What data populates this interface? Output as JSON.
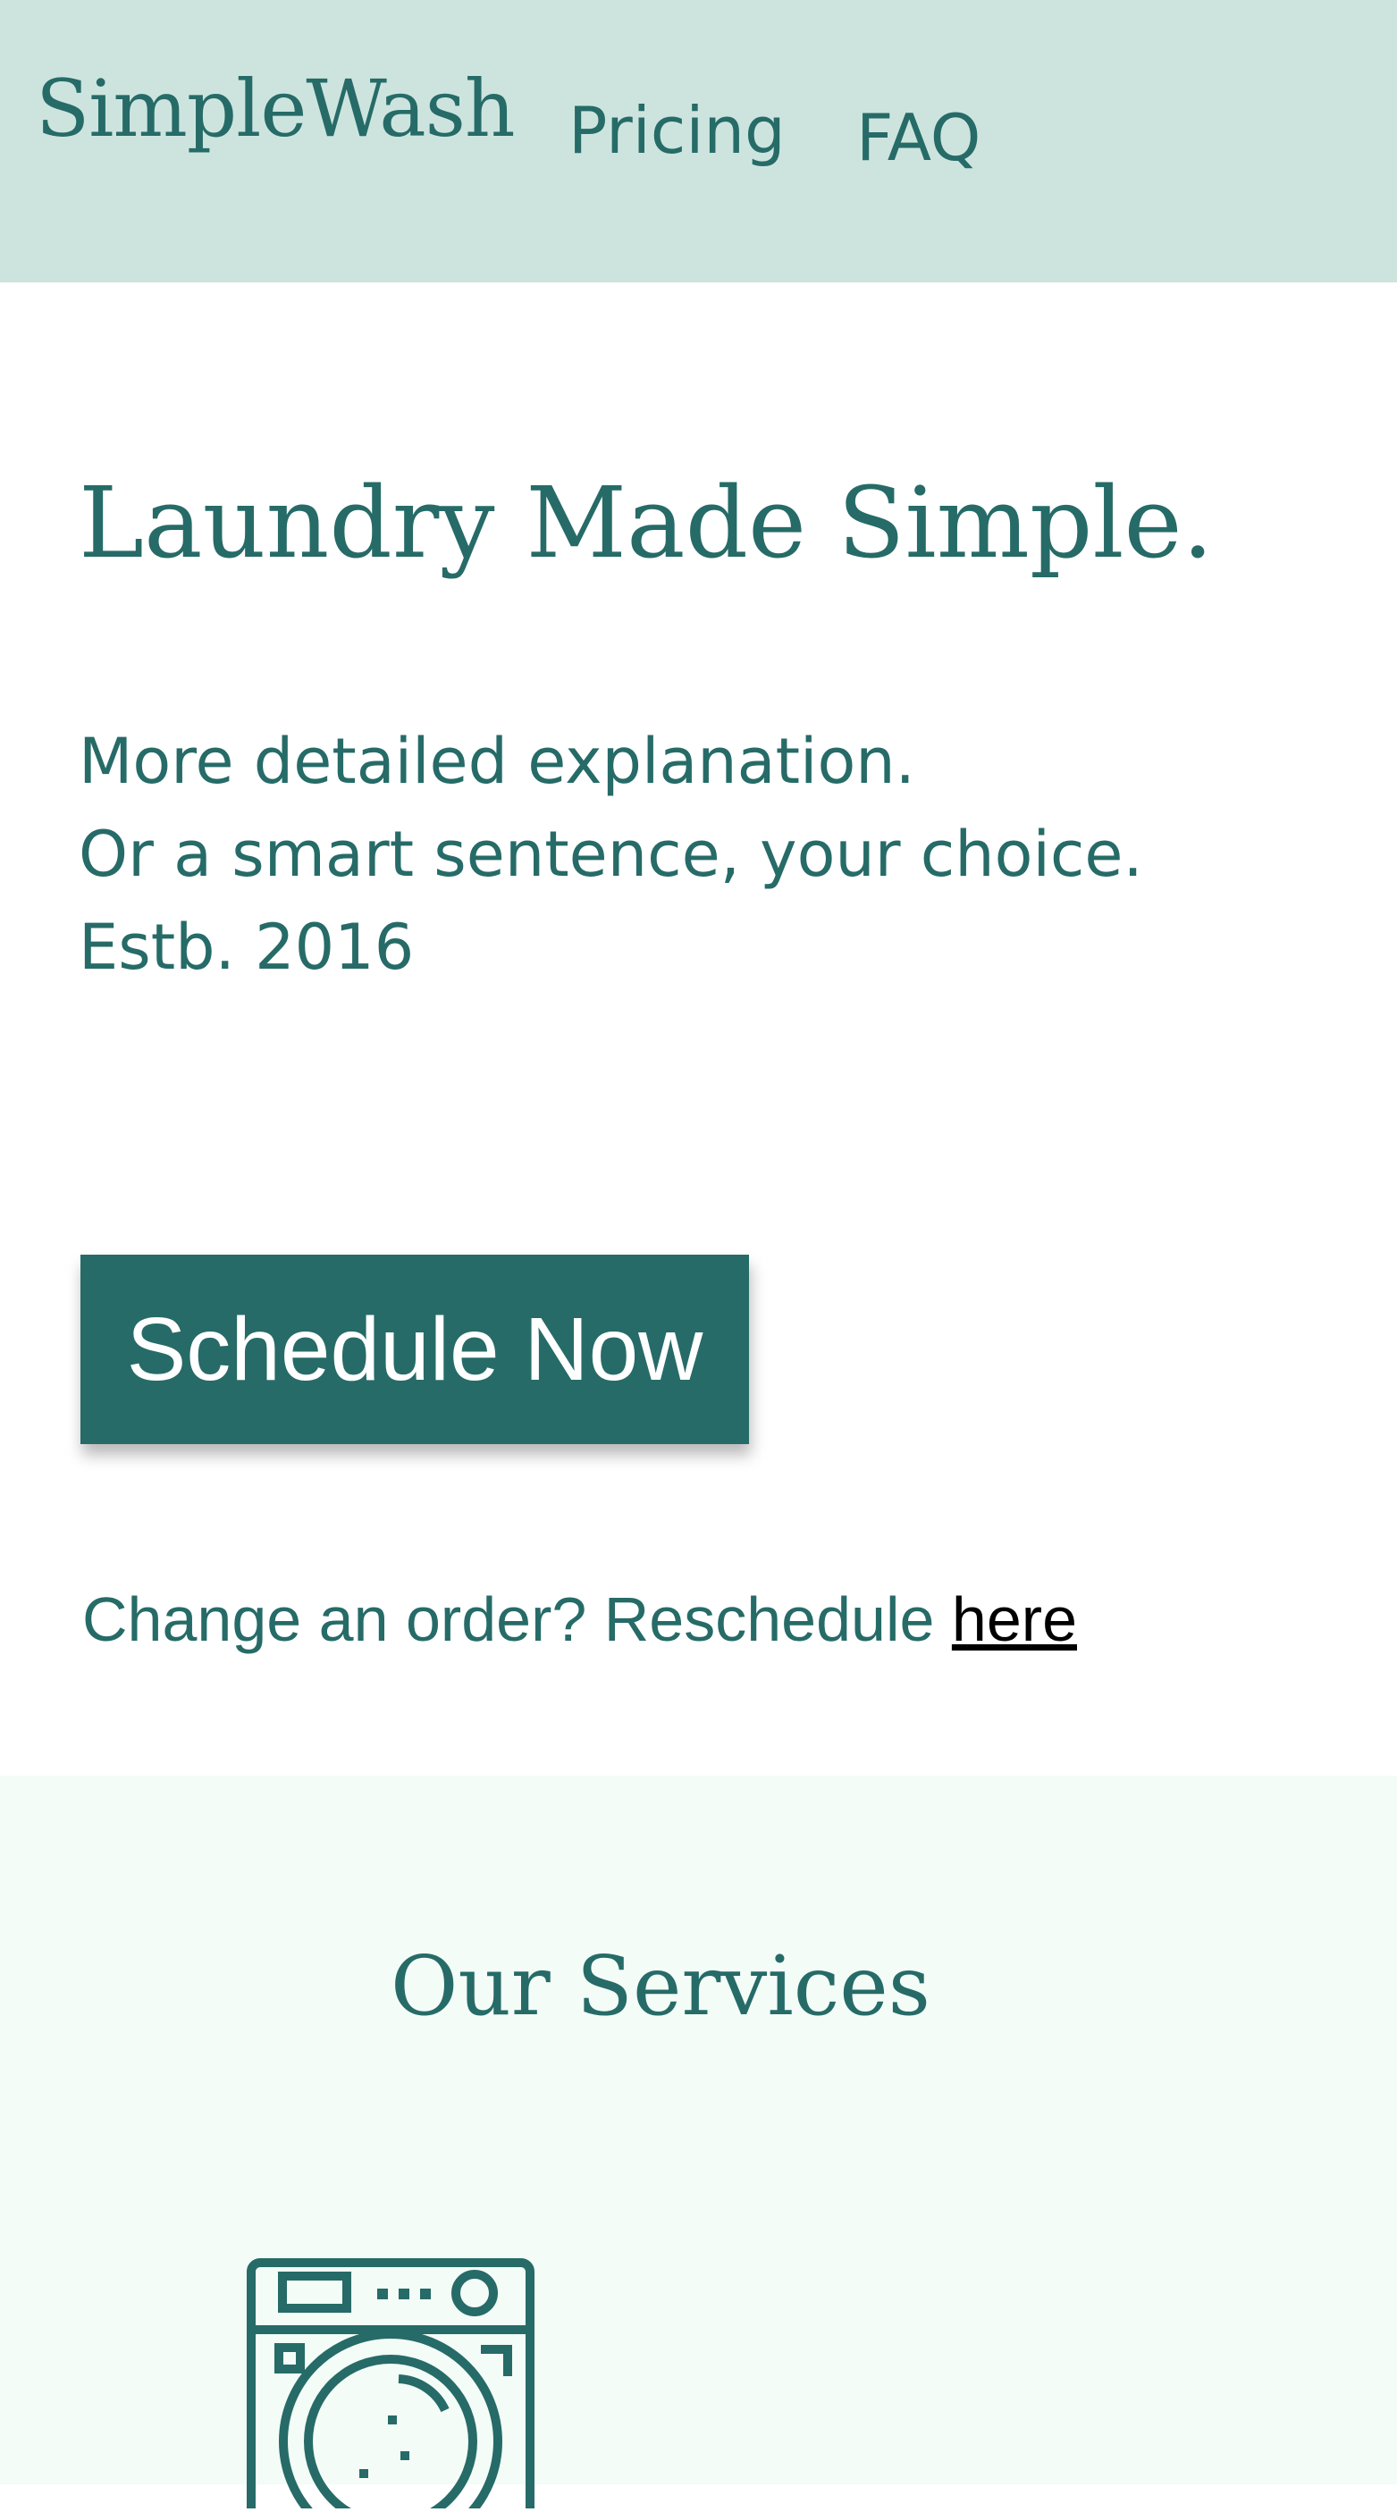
{
  "header": {
    "brand": "SimpleWash",
    "nav": [
      {
        "label": "Pricing"
      },
      {
        "label": "FAQ"
      }
    ],
    "background_color": "#cde4de"
  },
  "hero": {
    "title": "Laundry Made Simple.",
    "lines": [
      "More detailed explanation.",
      "Or a smart sentence, your choice.",
      "Estb. 2016"
    ],
    "cta_label": "Schedule Now",
    "reschedule_text": "Change an order? Reschedule ",
    "reschedule_link": "here"
  },
  "services": {
    "title": "Our Services",
    "icon": "washing-machine-icon",
    "background_color": "#f3fcf7"
  },
  "colors": {
    "accent": "#266b67",
    "button_text": "#ffffff",
    "link": "#000000"
  }
}
